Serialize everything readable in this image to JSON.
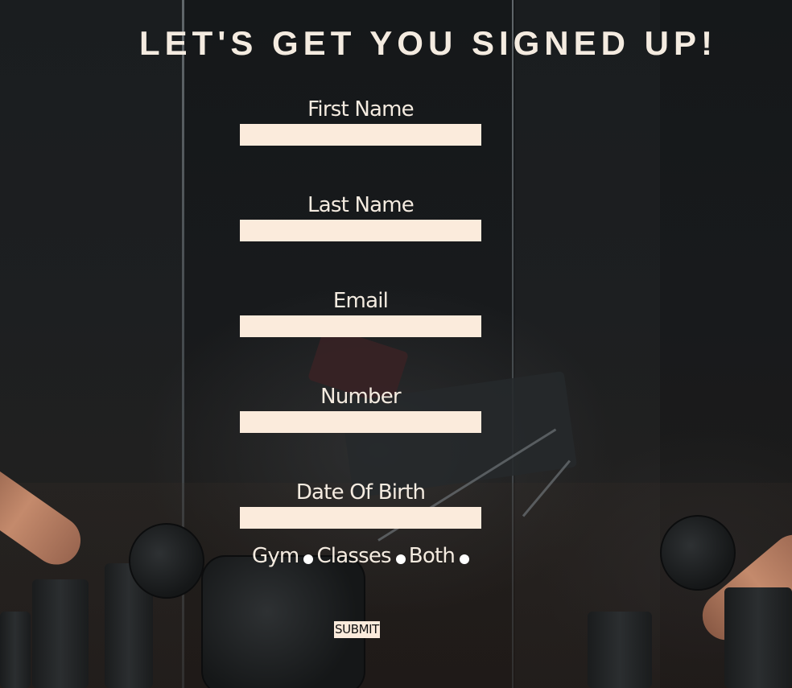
{
  "header": {
    "title": "LET'S GET YOU SIGNED UP!"
  },
  "form": {
    "fields": [
      {
        "label": "First Name",
        "value": "",
        "placeholder": ""
      },
      {
        "label": "Last Name",
        "value": "",
        "placeholder": ""
      },
      {
        "label": "Email",
        "value": "",
        "placeholder": ""
      },
      {
        "label": "Number",
        "value": "",
        "placeholder": ""
      },
      {
        "label": "Date Of Birth",
        "value": "",
        "placeholder": ""
      }
    ],
    "membership_options": [
      {
        "label": "Gym"
      },
      {
        "label": "Classes"
      },
      {
        "label": "Both"
      }
    ],
    "submit_label": "SUBMIT"
  },
  "colors": {
    "accent": "#fbebdc",
    "text": "#f4ebe0",
    "background": "#15181a"
  },
  "icons": {
    "radio": "radio-dot-icon"
  }
}
